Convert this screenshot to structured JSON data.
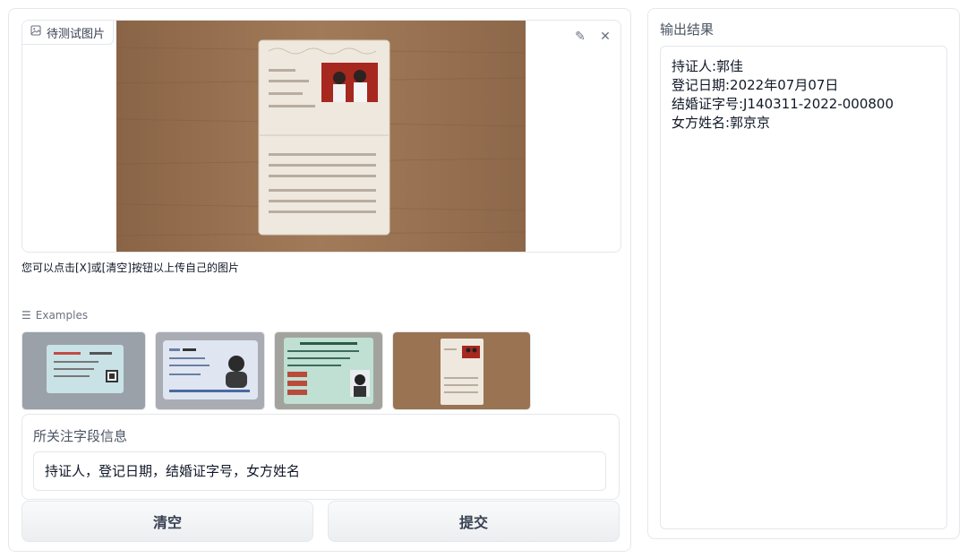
{
  "input_image": {
    "label": "待测试图片",
    "edit_icon": "pencil-icon",
    "close_icon": "close-icon"
  },
  "hint_text": "您可以点击[X]或[清空]按钮以上传自己的图片",
  "examples": {
    "title": "Examples",
    "items": [
      "train-ticket",
      "id-card",
      "driver-license",
      "marriage-certificate"
    ]
  },
  "field": {
    "label": "所关注字段信息",
    "value": "持证人，登记日期，结婚证字号，女方姓名"
  },
  "buttons": {
    "clear": "清空",
    "submit": "提交"
  },
  "output": {
    "label": "输出结果",
    "lines": [
      "持证人:郭佳",
      "登记日期:2022年07月07日",
      "结婚证字号:J140311-2022-000800",
      "女方姓名:郭京京"
    ]
  },
  "colors": {
    "wood": "#9a7352",
    "paper": "#efe8de"
  }
}
